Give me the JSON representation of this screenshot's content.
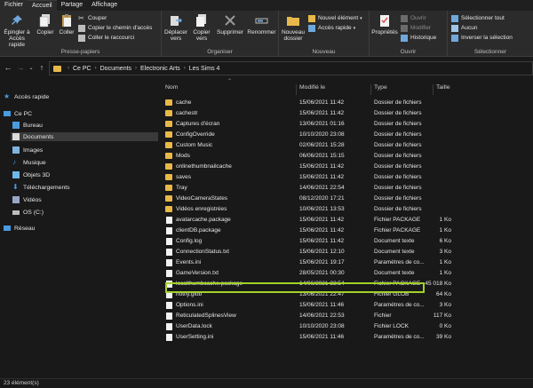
{
  "tabs": [
    {
      "label": "Fichier"
    },
    {
      "label": "Accueil"
    },
    {
      "label": "Partage"
    },
    {
      "label": "Affichage"
    }
  ],
  "ribbon": {
    "clipboard": {
      "pin": "Épingler à Accès rapide",
      "copy": "Copier",
      "paste": "Coller",
      "cut": "Couper",
      "copy_path": "Copier le chemin d'accès",
      "paste_shortcut": "Coller le raccourci",
      "title": "Presse-papiers"
    },
    "organize": {
      "move": "Déplacer vers",
      "copy_to": "Copier vers",
      "delete": "Supprimer",
      "rename": "Renommer",
      "title": "Organiser"
    },
    "new": {
      "new_folder": "Nouveau dossier",
      "new_item": "Nouvel élément",
      "quick_access": "Accès rapide",
      "title": "Nouveau"
    },
    "open": {
      "properties": "Propriétés",
      "open": "Ouvrir",
      "edit": "Modifier",
      "history": "Historique",
      "title": "Ouvrir"
    },
    "select": {
      "select_all": "Sélectionner tout",
      "select_none": "Aucun",
      "invert": "Inverser la sélection",
      "title": "Sélectionner"
    }
  },
  "address": {
    "crumbs": [
      "Ce PC",
      "Documents",
      "Electronic Arts",
      "Les Sims 4"
    ]
  },
  "nav": {
    "quick_access": "Accès rapide",
    "this_pc": "Ce PC",
    "items": [
      "Bureau",
      "Documents",
      "Images",
      "Musique",
      "Objets 3D",
      "Téléchargements",
      "Vidéos",
      "OS (C:)"
    ],
    "network": "Réseau"
  },
  "columns": {
    "name": "Nom",
    "modified": "Modifié le",
    "type": "Type",
    "size": "Taille"
  },
  "files": [
    {
      "name": "cache",
      "date": "15/06/2021 11:42",
      "type": "Dossier de fichiers",
      "size": "",
      "kind": "folder"
    },
    {
      "name": "cachestr",
      "date": "15/06/2021 11:42",
      "type": "Dossier de fichiers",
      "size": "",
      "kind": "folder"
    },
    {
      "name": "Captures d'écran",
      "date": "13/06/2021 01:16",
      "type": "Dossier de fichiers",
      "size": "",
      "kind": "folder"
    },
    {
      "name": "ConfigOverride",
      "date": "10/10/2020 23:08",
      "type": "Dossier de fichiers",
      "size": "",
      "kind": "folder"
    },
    {
      "name": "Custom Music",
      "date": "02/06/2021 15:28",
      "type": "Dossier de fichiers",
      "size": "",
      "kind": "folder"
    },
    {
      "name": "Mods",
      "date": "06/06/2021 15:15",
      "type": "Dossier de fichiers",
      "size": "",
      "kind": "folder"
    },
    {
      "name": "onlinethumbnailcache",
      "date": "15/06/2021 11:42",
      "type": "Dossier de fichiers",
      "size": "",
      "kind": "folder"
    },
    {
      "name": "saves",
      "date": "15/06/2021 11:42",
      "type": "Dossier de fichiers",
      "size": "",
      "kind": "folder"
    },
    {
      "name": "Tray",
      "date": "14/06/2021 22:54",
      "type": "Dossier de fichiers",
      "size": "",
      "kind": "folder"
    },
    {
      "name": "VideoCameraStates",
      "date": "08/12/2020 17:21",
      "type": "Dossier de fichiers",
      "size": "",
      "kind": "folder"
    },
    {
      "name": "Vidéos enregistrées",
      "date": "10/06/2021 13:53",
      "type": "Dossier de fichiers",
      "size": "",
      "kind": "folder"
    },
    {
      "name": "avatarcache.package",
      "date": "15/06/2021 11:42",
      "type": "Fichier PACKAGE",
      "size": "1 Ko",
      "kind": "file"
    },
    {
      "name": "clientDB.package",
      "date": "15/06/2021 11:42",
      "type": "Fichier PACKAGE",
      "size": "1 Ko",
      "kind": "file"
    },
    {
      "name": "Config.log",
      "date": "15/06/2021 11:42",
      "type": "Document texte",
      "size": "6 Ko",
      "kind": "file"
    },
    {
      "name": "ConnectionStatus.txt",
      "date": "15/06/2021 12:10",
      "type": "Document texte",
      "size": "3 Ko",
      "kind": "file"
    },
    {
      "name": "Events.ini",
      "date": "15/06/2021 19:17",
      "type": "Paramètres de co...",
      "size": "1 Ko",
      "kind": "file"
    },
    {
      "name": "GameVersion.txt",
      "date": "28/05/2021 00:30",
      "type": "Document texte",
      "size": "1 Ko",
      "kind": "file"
    },
    {
      "name": "localthumbcache.package",
      "date": "14/06/2021 23:54",
      "type": "Fichier PACKAGE",
      "size": "45 018 Ko",
      "kind": "file"
    },
    {
      "name": "notify.glob",
      "date": "13/06/2021 22:47",
      "type": "Fichier GLOB",
      "size": "64 Ko",
      "kind": "file"
    },
    {
      "name": "Options.ini",
      "date": "15/06/2021 11:46",
      "type": "Paramètres de co...",
      "size": "3 Ko",
      "kind": "file"
    },
    {
      "name": "ReticulatedSplinesView",
      "date": "14/06/2021 22:53",
      "type": "Fichier",
      "size": "117 Ko",
      "kind": "file"
    },
    {
      "name": "UserData.lock",
      "date": "10/10/2020 23:08",
      "type": "Fichier LOCK",
      "size": "0 Ko",
      "kind": "file"
    },
    {
      "name": "UserSetting.ini",
      "date": "15/06/2021 11:46",
      "type": "Paramètres de co...",
      "size": "39 Ko",
      "kind": "file"
    }
  ],
  "status": "23 élément(s)"
}
